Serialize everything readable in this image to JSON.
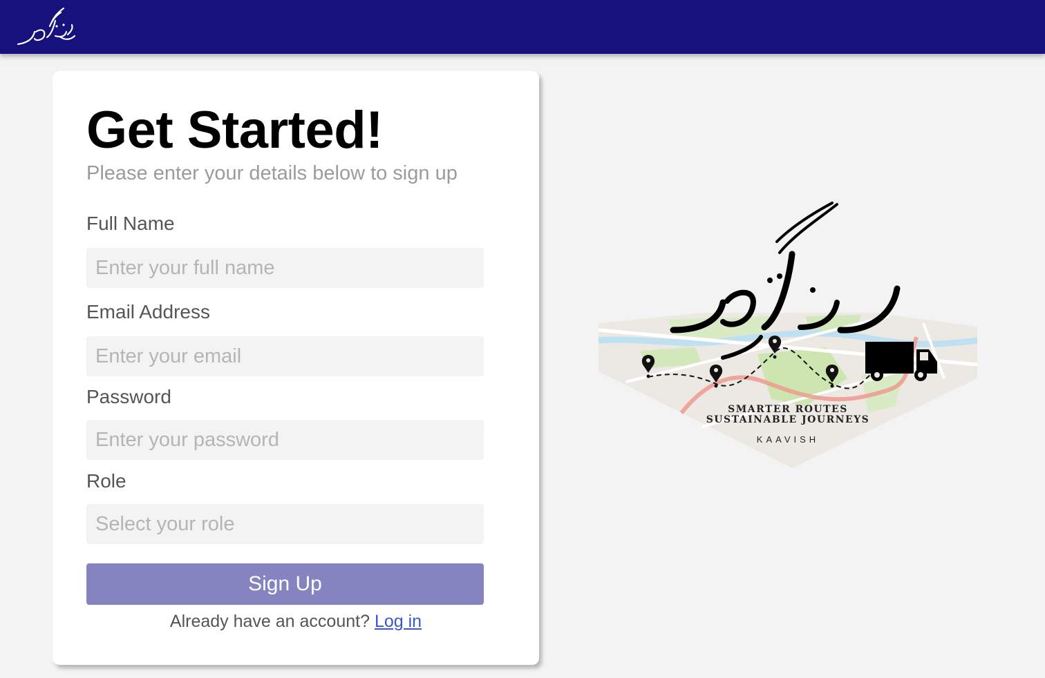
{
  "header": {
    "logo_alt": "ره گزر",
    "brand_color": "#16117d"
  },
  "form": {
    "title": "Get Started!",
    "subtitle": "Please enter your details below to sign up",
    "full_name": {
      "label": "Full Name",
      "placeholder": "Enter your full name",
      "value": ""
    },
    "email": {
      "label": "Email Address",
      "placeholder": "Enter your email",
      "value": ""
    },
    "password": {
      "label": "Password",
      "placeholder": "Enter your password",
      "value": ""
    },
    "role": {
      "label": "Role",
      "placeholder": "Select your role",
      "value": ""
    },
    "submit_label": "Sign Up",
    "submit_color": "#8584c0",
    "login_prompt": "Already have an account?",
    "login_link": "Log in"
  },
  "hero": {
    "tagline_line1": "SMARTER ROUTES",
    "tagline_line2": "SUSTAINABLE JOURNEYS",
    "brand": "KAAVISH",
    "logo_text": "ره گزر"
  }
}
